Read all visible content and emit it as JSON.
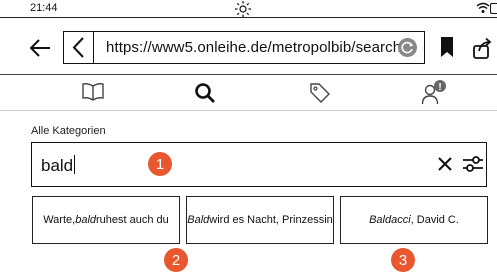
{
  "status_bar": {
    "time": "21:44",
    "icons": [
      "brightness-icon",
      "wifi-icon",
      "battery-icon"
    ]
  },
  "browser": {
    "url": "https://www5.onleihe.de/metropolbib/search",
    "icons": [
      "back-arrow-icon",
      "url-back-icon",
      "reload-icon",
      "bookmark-icon",
      "share-icon"
    ]
  },
  "nav": {
    "items": [
      {
        "name": "library",
        "icon": "book-icon"
      },
      {
        "name": "search",
        "icon": "search-icon",
        "active": true
      },
      {
        "name": "tags",
        "icon": "tag-icon"
      },
      {
        "name": "account",
        "icon": "user-icon",
        "badge": "!"
      }
    ]
  },
  "search": {
    "category_label": "Alle Kategorien",
    "query": "bald"
  },
  "suggestions": [
    {
      "pre": "Warte, ",
      "em": "bald",
      "post": " ruhest auch du"
    },
    {
      "pre": "",
      "em": "Bald",
      "post": " wird es Nacht, Prinzessin"
    },
    {
      "pre": "",
      "em": "Baldacci",
      "post": ", David C."
    }
  ],
  "markers": [
    "1",
    "2",
    "3"
  ],
  "colors": {
    "marker": "#e8572e",
    "text": "#111111",
    "reload": "#888888"
  }
}
